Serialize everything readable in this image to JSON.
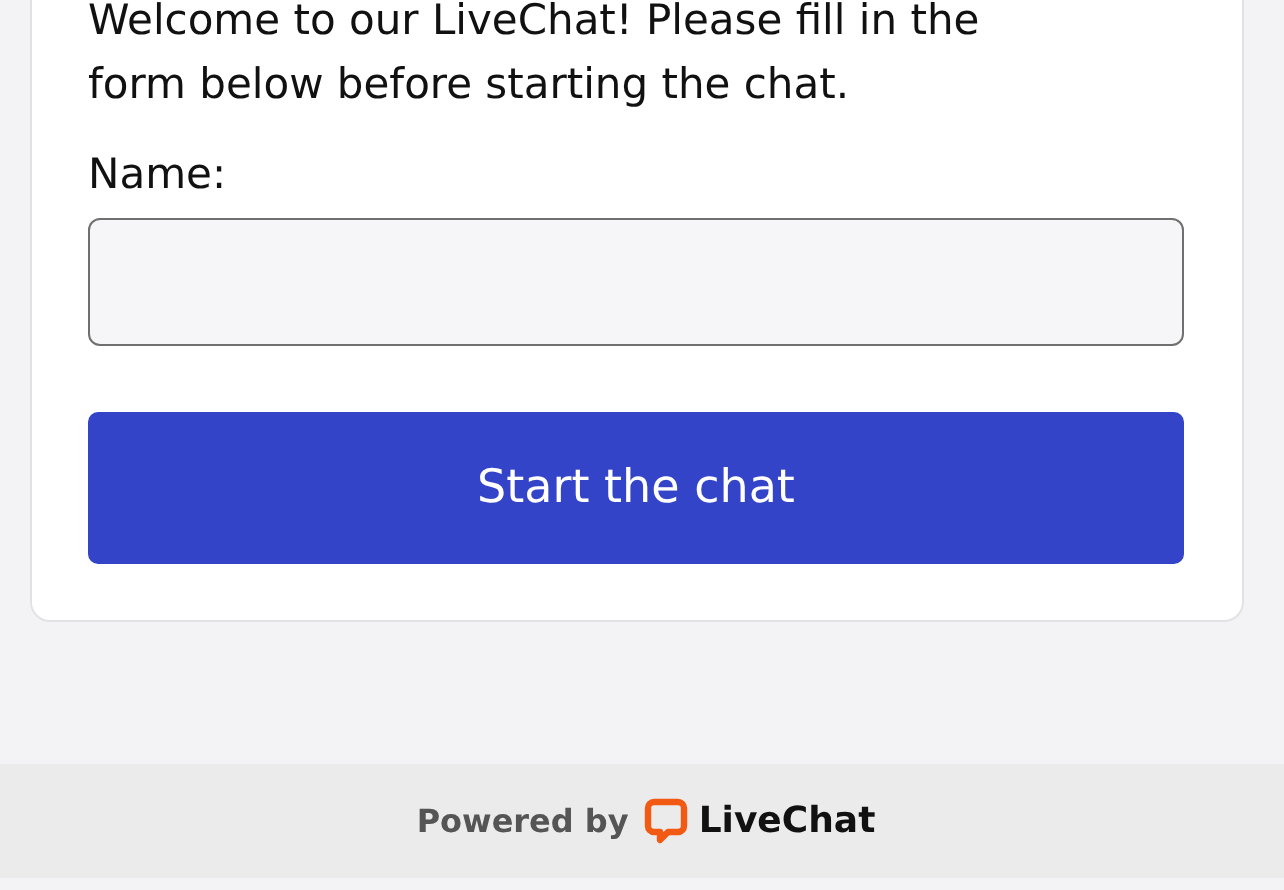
{
  "form": {
    "intro": "Welcome to our LiveChat! Please fill in the form below before starting the chat.",
    "fields": [
      {
        "label": "Name:"
      }
    ],
    "submit": "Start the chat"
  },
  "footer": {
    "powered_by": "Powered by",
    "brand": "LiveChat"
  }
}
